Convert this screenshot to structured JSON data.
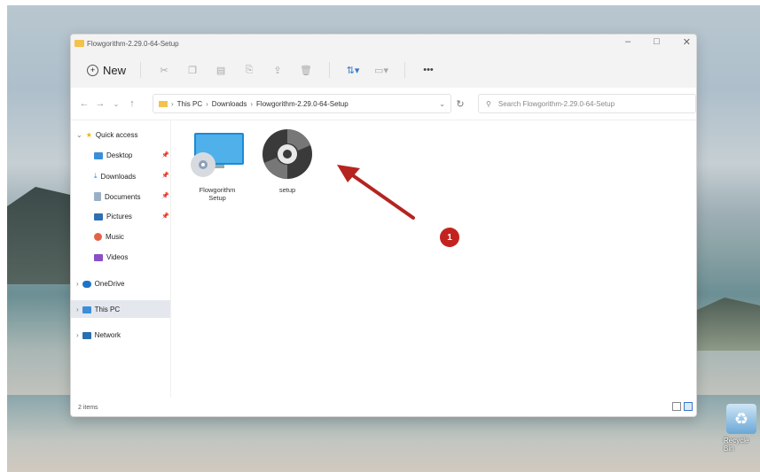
{
  "window": {
    "title": "Flowgorithm-2.29.0-64-Setup"
  },
  "toolbar": {
    "new_label": "New"
  },
  "address": {
    "crumbs": [
      "This PC",
      "Downloads",
      "Flowgorithm-2.29.0-64-Setup"
    ],
    "search_placeholder": "Search Flowgorithm-2.29.0-64-Setup"
  },
  "sidebar": {
    "quick_access": "Quick access",
    "items": [
      "Desktop",
      "Downloads",
      "Documents",
      "Pictures",
      "Music",
      "Videos"
    ],
    "onedrive": "OneDrive",
    "this_pc": "This PC",
    "network": "Network"
  },
  "files": [
    {
      "name_line1": "Flowgorithm",
      "name_line2": "Setup",
      "icon": "installer-icon"
    },
    {
      "name_line1": "setup",
      "icon": "disc-icon"
    }
  ],
  "status": {
    "items": "2 items"
  },
  "annotation": {
    "step": "1",
    "color": "#c3231e"
  },
  "desktop": {
    "recycle_label": "Recycle Bin"
  }
}
